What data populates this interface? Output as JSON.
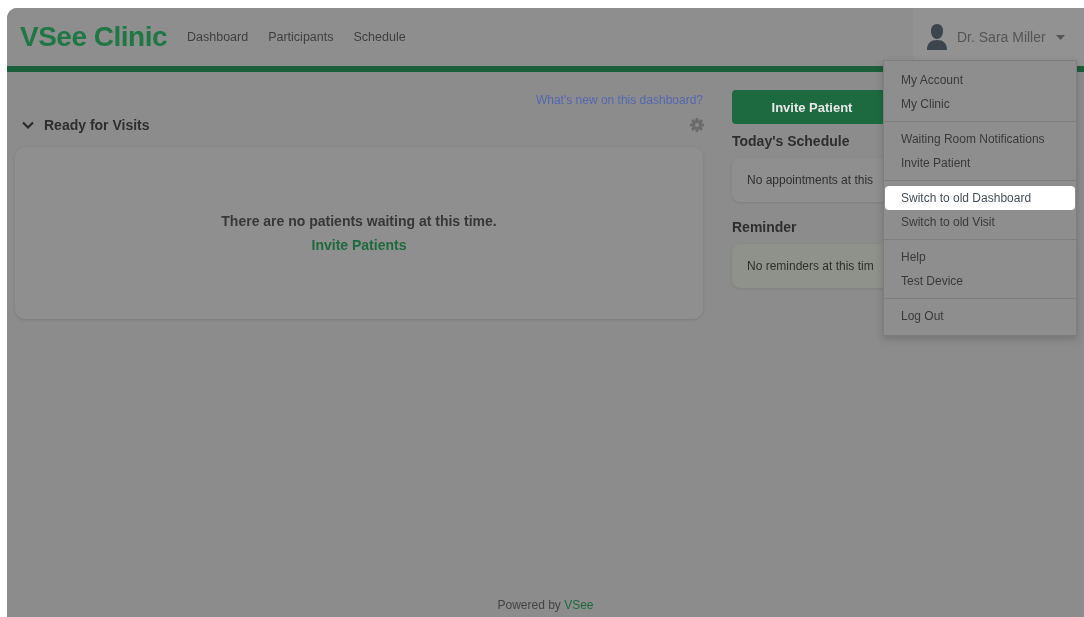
{
  "header": {
    "logo": "VSee Clinic",
    "nav": [
      "Dashboard",
      "Participants",
      "Schedule"
    ],
    "user": {
      "name": "Dr. Sara Miller"
    }
  },
  "dashboard_link": "What's new on this dashboard?",
  "ready_section": {
    "title": "Ready for Visits",
    "expanded": true,
    "message": "There are no patients waiting at this time.",
    "action": "Invite Patients"
  },
  "invite_button": "Invite Patient",
  "schedule": {
    "title": "Today's Schedule",
    "message": "No appointments at this"
  },
  "reminder": {
    "title": "Reminder",
    "message": "No reminders at this tim"
  },
  "user_menu": {
    "groups": [
      {
        "items": [
          {
            "label": "My Account",
            "selected": false
          },
          {
            "label": "My Clinic",
            "selected": false
          }
        ]
      },
      {
        "items": [
          {
            "label": "Waiting Room Notifications",
            "selected": false
          },
          {
            "label": "Invite Patient",
            "selected": false
          }
        ]
      },
      {
        "items": [
          {
            "label": "Switch to old Dashboard",
            "selected": true
          },
          {
            "label": "Switch to old Visit",
            "selected": false
          }
        ]
      },
      {
        "items": [
          {
            "label": "Help",
            "selected": false
          },
          {
            "label": "Test Device",
            "selected": false
          }
        ]
      },
      {
        "items": [
          {
            "label": "Log Out",
            "selected": false
          }
        ]
      }
    ]
  },
  "footer": {
    "text": "Powered by",
    "brand": "VSee"
  }
}
